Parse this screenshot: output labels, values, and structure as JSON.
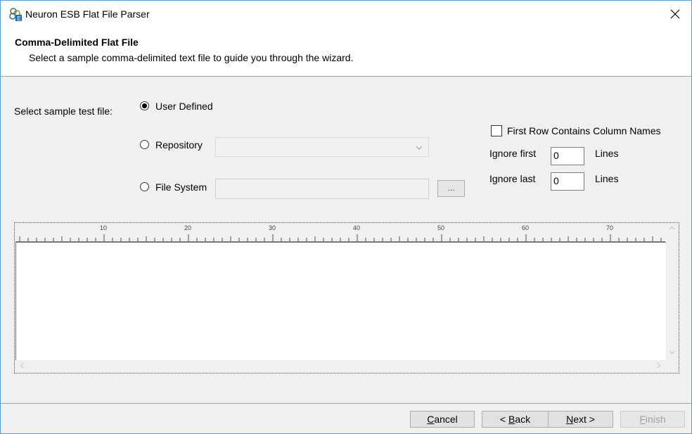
{
  "window": {
    "title": "Neuron ESB Flat File Parser",
    "close_glyph": "✕"
  },
  "header": {
    "title": "Comma-Delimited Flat File",
    "subtitle": "Select a sample comma-delimited text file to guide you through the wizard."
  },
  "source": {
    "label": "Select sample test file:",
    "options": [
      {
        "label": "User Defined",
        "checked": true
      },
      {
        "label": "Repository",
        "checked": false
      },
      {
        "label": "File System",
        "checked": false
      }
    ],
    "repository_value": "",
    "file_path_value": "",
    "browse_label": "..."
  },
  "options_panel": {
    "first_row_label": "First Row Contains Column Names",
    "first_row_checked": false,
    "ignore_first_label": "Ignore first",
    "ignore_first_value": "0",
    "ignore_last_label": "Ignore last",
    "ignore_last_value": "0",
    "lines_label": "Lines"
  },
  "ruler": {
    "labels": [
      "10",
      "20",
      "30",
      "40",
      "50",
      "60",
      "70"
    ]
  },
  "buttons": {
    "cancel": {
      "accel": "C",
      "rest": "ancel"
    },
    "back": {
      "pre": "< ",
      "accel": "B",
      "rest": "ack"
    },
    "next": {
      "accel": "N",
      "rest": "ext >"
    },
    "finish": {
      "accel": "F",
      "rest": "inish"
    }
  },
  "colors": {
    "window_border": "#5b9bd5",
    "dialog_bg": "#f0f0f0",
    "header_bg": "#ffffff"
  }
}
